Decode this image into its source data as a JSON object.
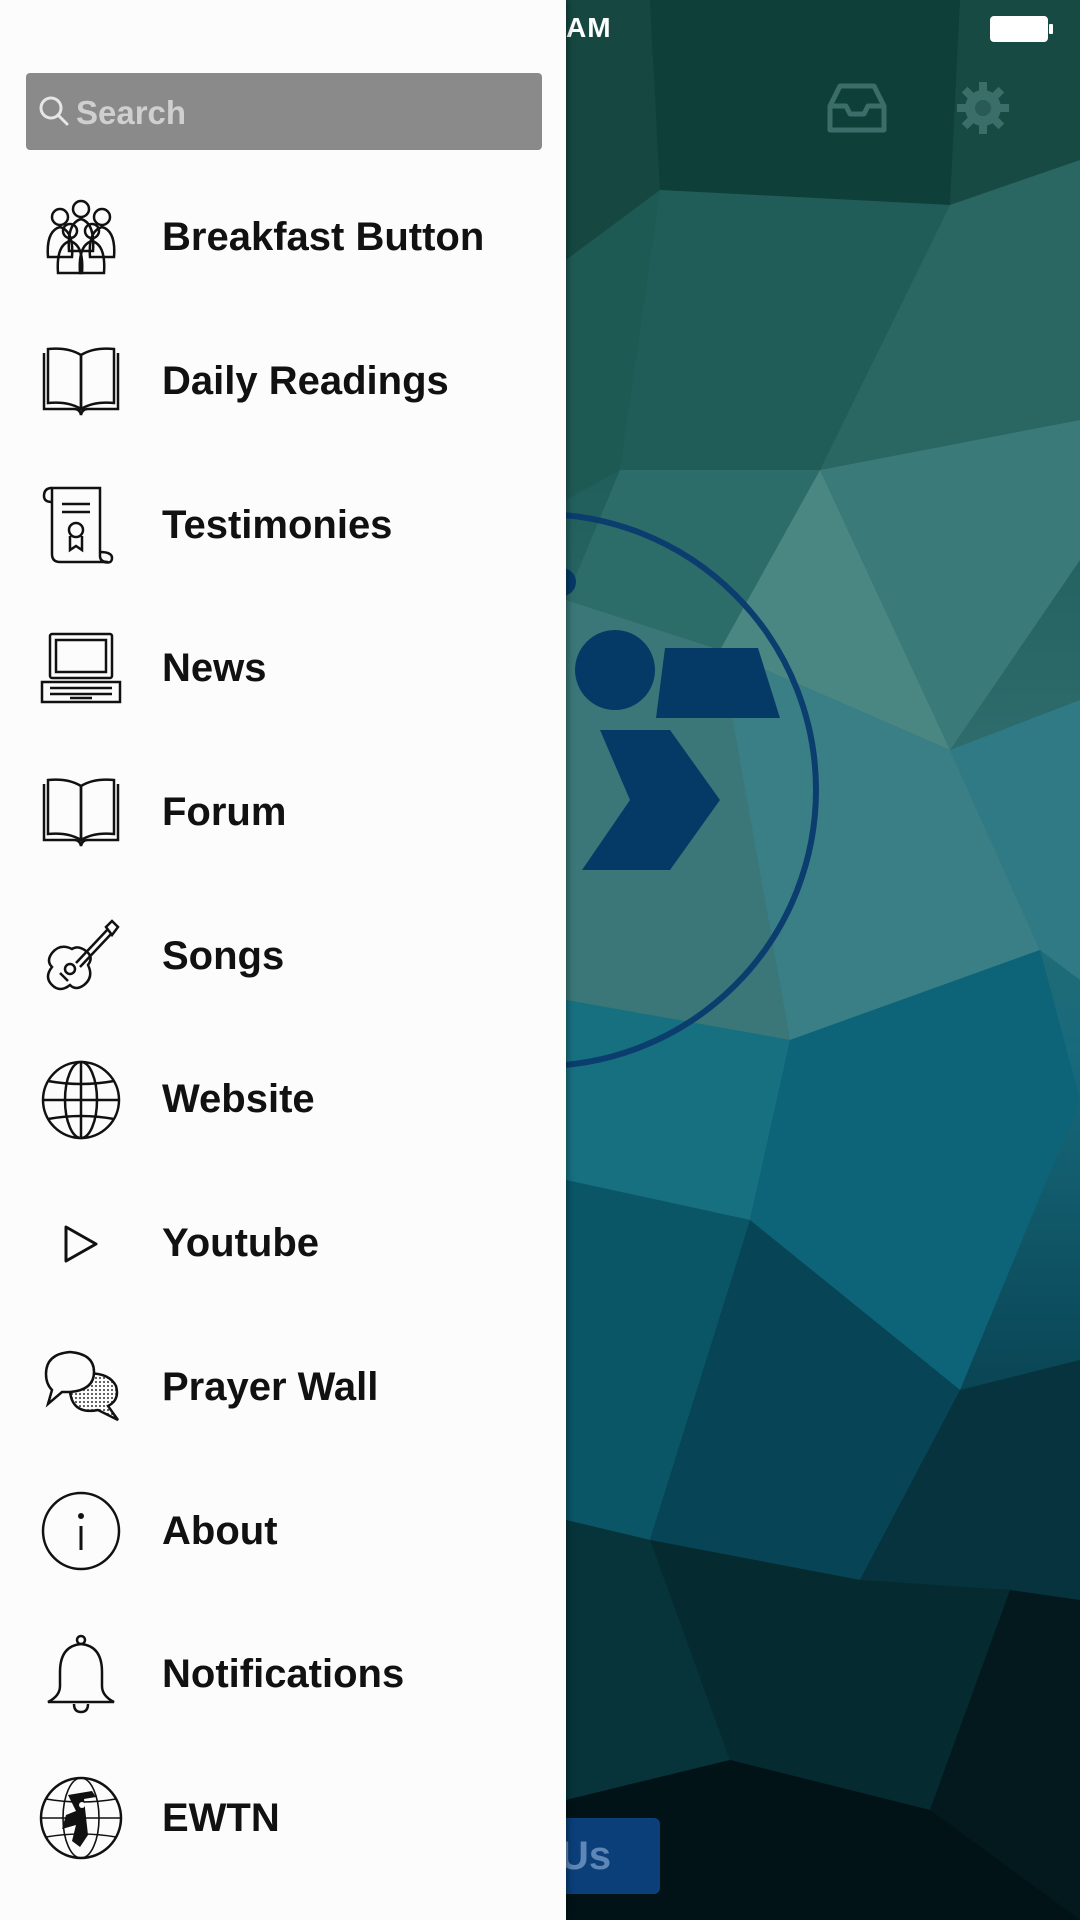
{
  "status_bar": {
    "time_fragment": "AM"
  },
  "search": {
    "placeholder": "Search"
  },
  "menu": [
    {
      "label": "Breakfast Button",
      "icon": "group-people-icon"
    },
    {
      "label": "Daily Readings",
      "icon": "open-book-icon"
    },
    {
      "label": "Testimonies",
      "icon": "scroll-certificate-icon"
    },
    {
      "label": "News",
      "icon": "laptop-icon"
    },
    {
      "label": "Forum",
      "icon": "open-book-icon"
    },
    {
      "label": "Songs",
      "icon": "guitar-icon"
    },
    {
      "label": "Website",
      "icon": "globe-icon"
    },
    {
      "label": "Youtube",
      "icon": "play-icon"
    },
    {
      "label": "Prayer Wall",
      "icon": "chat-bubbles-icon"
    },
    {
      "label": "About",
      "icon": "info-icon"
    },
    {
      "label": "Notifications",
      "icon": "bell-icon"
    },
    {
      "label": "EWTN",
      "icon": "ewtn-globe-icon"
    }
  ],
  "background_app": {
    "bottom_button_partial": "Us",
    "header_icons": [
      "inbox-icon",
      "gear-icon"
    ],
    "accent_color": "#0a3f7a"
  }
}
